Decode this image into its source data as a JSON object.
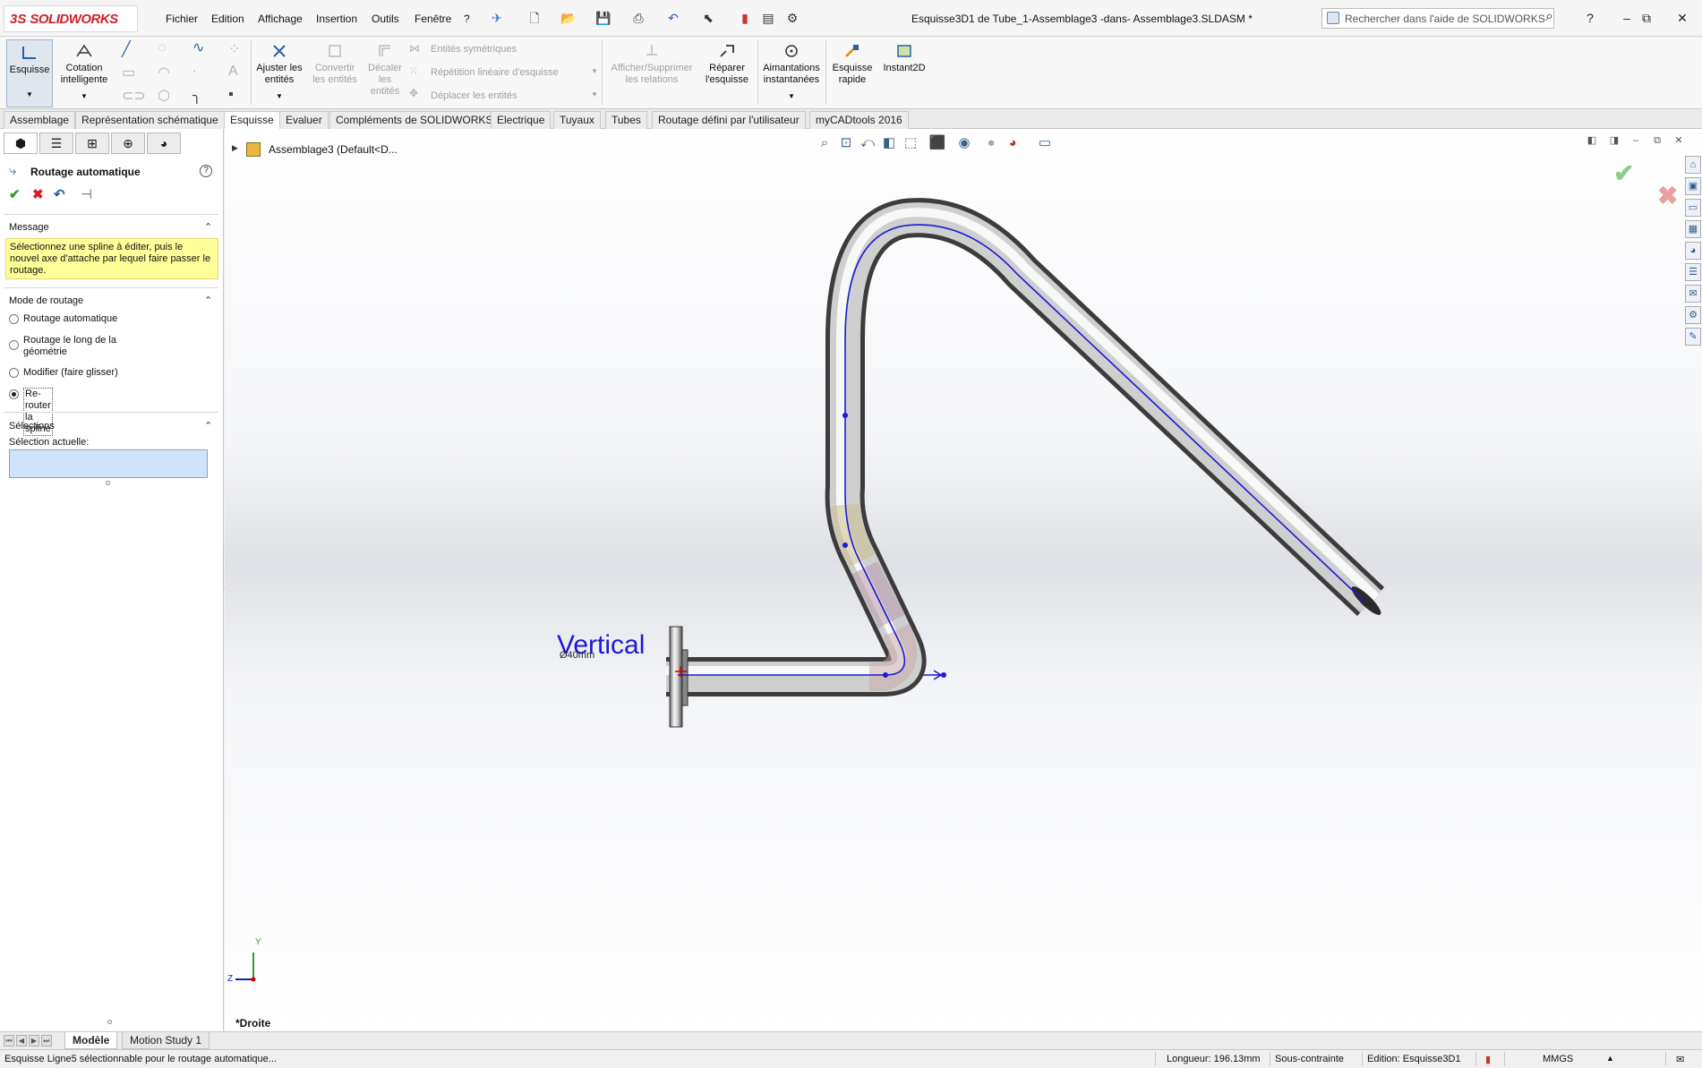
{
  "app": {
    "logo_ds": "3S",
    "logo_name": "SOLIDWORKS",
    "document_title": "Esquisse3D1 de Tube_1-Assemblage3 -dans- Assemblage3.SLDASM *"
  },
  "menu": {
    "items": [
      "Fichier",
      "Edition",
      "Affichage",
      "Insertion",
      "Outils",
      "Fenêtre",
      "?"
    ]
  },
  "search": {
    "placeholder": "Rechercher dans l'aide de SOLIDWORKS"
  },
  "ribbon": {
    "esquisse": "Esquisse",
    "cotation_1": "Cotation",
    "cotation_2": "intelligente",
    "ajuster_1": "Ajuster les",
    "ajuster_2": "entités",
    "convertir_1": "Convertir",
    "convertir_2": "les entités",
    "decaler_1": "Décaler",
    "decaler_2": "les",
    "decaler_3": "entités",
    "entites_symetriques": "Entités symétriques",
    "repetition": "Répétition linéaire d'esquisse",
    "deplacer": "Déplacer les entités",
    "afficher_1": "Afficher/Supprimer",
    "afficher_2": "les relations",
    "reparer_1": "Réparer",
    "reparer_2": "l'esquisse",
    "aimantations_1": "Aimantations",
    "aimantations_2": "instantanées",
    "esquisse_rapide_1": "Esquisse",
    "esquisse_rapide_2": "rapide",
    "instant2d": "Instant2D"
  },
  "tabs": [
    "Assemblage",
    "Représentation schématique",
    "Esquisse",
    "Evaluer",
    "Compléments de SOLIDWORKS",
    "Electrique",
    "Tuyaux",
    "Tubes",
    "Routage défini par l'utilisateur",
    "myCADtools 2016"
  ],
  "active_tab": "Esquisse",
  "property_manager": {
    "title": "Routage automatique",
    "message_header": "Message",
    "message_text": "Sélectionnez une spline à éditer, puis le nouvel axe d'attache par lequel faire passer le routage.",
    "mode_header": "Mode de routage",
    "modes": [
      {
        "label": "Routage automatique",
        "selected": false
      },
      {
        "label": "Routage le long de la géométrie",
        "selected": false
      },
      {
        "label": "Modifier (faire glisser)",
        "selected": false
      },
      {
        "label": "Re-router la spline",
        "selected": true
      }
    ],
    "selections_header": "Sélections",
    "selection_label": "Sélection actuelle:"
  },
  "tree": {
    "root": "Assemblage3  (Default<D..."
  },
  "viewport": {
    "annotation": "Vertical",
    "annotation_small": "Ø40mm",
    "view_name": "*Droite",
    "triad_y": "Y",
    "triad_z": "Z"
  },
  "bottom_tabs": [
    "Modèle",
    "Motion Study 1"
  ],
  "status": {
    "message": "Esquisse Ligne5 sélectionnable pour le routage automatique...",
    "longueur": "Longueur: 196.13mm",
    "contrainte": "Sous-contrainte",
    "edition": "Edition: Esquisse3D1",
    "units": "MMGS"
  },
  "colors": {
    "brand": "#cc2229",
    "message_bg": "#ffff99",
    "selection_bg": "#cfe3f9",
    "sketch_line": "#1a1ad6"
  }
}
